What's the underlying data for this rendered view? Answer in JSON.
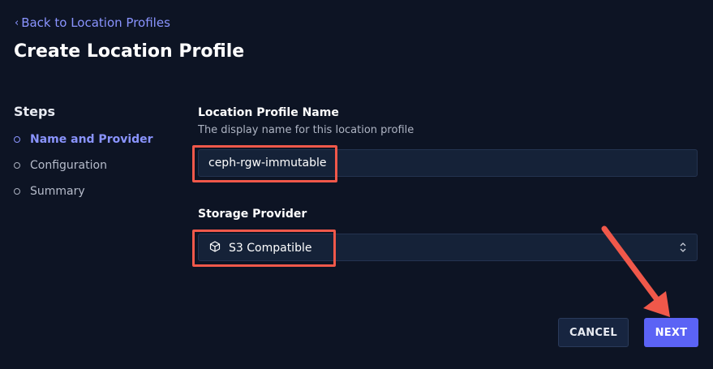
{
  "nav": {
    "back_label": "Back to Location Profiles",
    "back_icon": "chevron-left-icon"
  },
  "page": {
    "title": "Create Location Profile"
  },
  "steps": {
    "title": "Steps",
    "items": [
      {
        "label": "Name and Provider",
        "active": true
      },
      {
        "label": "Configuration",
        "active": false
      },
      {
        "label": "Summary",
        "active": false
      }
    ]
  },
  "form": {
    "name": {
      "label": "Location Profile Name",
      "help": "The display name for this location profile",
      "value": "ceph-rgw-immutable"
    },
    "provider": {
      "label": "Storage Provider",
      "value": "S3 Compatible",
      "icon": "cube-icon"
    }
  },
  "actions": {
    "cancel_label": "CANCEL",
    "next_label": "NEXT"
  },
  "colors": {
    "background": "#0d1424",
    "accent": "#5b63f5",
    "link": "#8a94ff",
    "annotation": "#f0584a"
  }
}
